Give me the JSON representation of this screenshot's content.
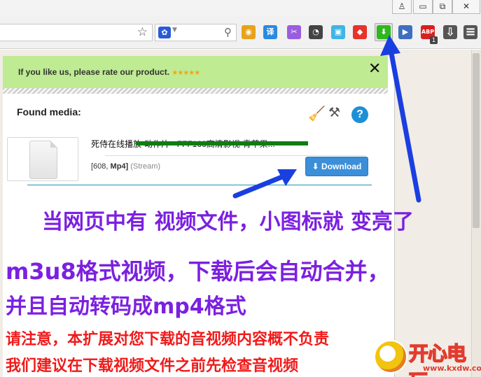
{
  "browser": {
    "window_controls": [
      "♙",
      "▭",
      "⧉",
      "✕"
    ],
    "toolbar_icons": [
      {
        "name": "chrome-icon",
        "glyph": "◉",
        "color": "#e8a31a"
      },
      {
        "name": "translate-icon",
        "glyph": "译",
        "color": "#2a8ae0"
      },
      {
        "name": "scissors-icon",
        "glyph": "✂",
        "color": "#9a5de0"
      },
      {
        "name": "owl-icon",
        "glyph": "◔",
        "color": "#444444"
      },
      {
        "name": "screenshot-icon",
        "glyph": "▣",
        "color": "#3fb4e6"
      },
      {
        "name": "shield-icon",
        "glyph": "◆",
        "color": "#e8332a"
      },
      {
        "name": "download-arrow-icon",
        "glyph": "⬇",
        "color": "#2fb81e"
      },
      {
        "name": "bookmark-icon",
        "glyph": "▶",
        "color": "#3f6fbf"
      },
      {
        "name": "adblock-icon",
        "glyph": "ABP",
        "color": "#d8201f"
      },
      {
        "name": "downloads-icon",
        "glyph": "⇩",
        "color": "#555555"
      },
      {
        "name": "menu-icon",
        "glyph": "≡",
        "color": "#555555"
      }
    ],
    "adblock_badge": "1"
  },
  "popup": {
    "rate_text": "If you like us, please rate our product.",
    "rate_stars": "★★★★★",
    "close_label": "✕",
    "found_label": "Found media:",
    "media_title": "死侍在线播放-动作片 - FFF166高清影视-青苹果...",
    "media_meta_size": "[608,",
    "media_meta_format": "Mp4]",
    "media_meta_stream": "(Stream)",
    "download_button": "Download",
    "help_label": "?"
  },
  "annotations": {
    "line1": "当网页中有 视频文件，小图标就 变亮了",
    "line2": "m3u8格式视频，下载后会自动合并，",
    "line3": "并且自动转码成mp4格式",
    "line4": "请注意，本扩展对您下载的音视频内容概不负责",
    "line5": "我们建议在下载视频文件之前先检查音视频"
  },
  "watermark": {
    "brand": "开心电玩",
    "url": "www.kxdw.com"
  },
  "colors": {
    "rate_bar": "#bfeb93",
    "download_button": "#3b8fd8",
    "annotation_purple": "#7b20e0",
    "annotation_red": "#f01a1a",
    "arrow_blue": "#1a3fe0"
  }
}
